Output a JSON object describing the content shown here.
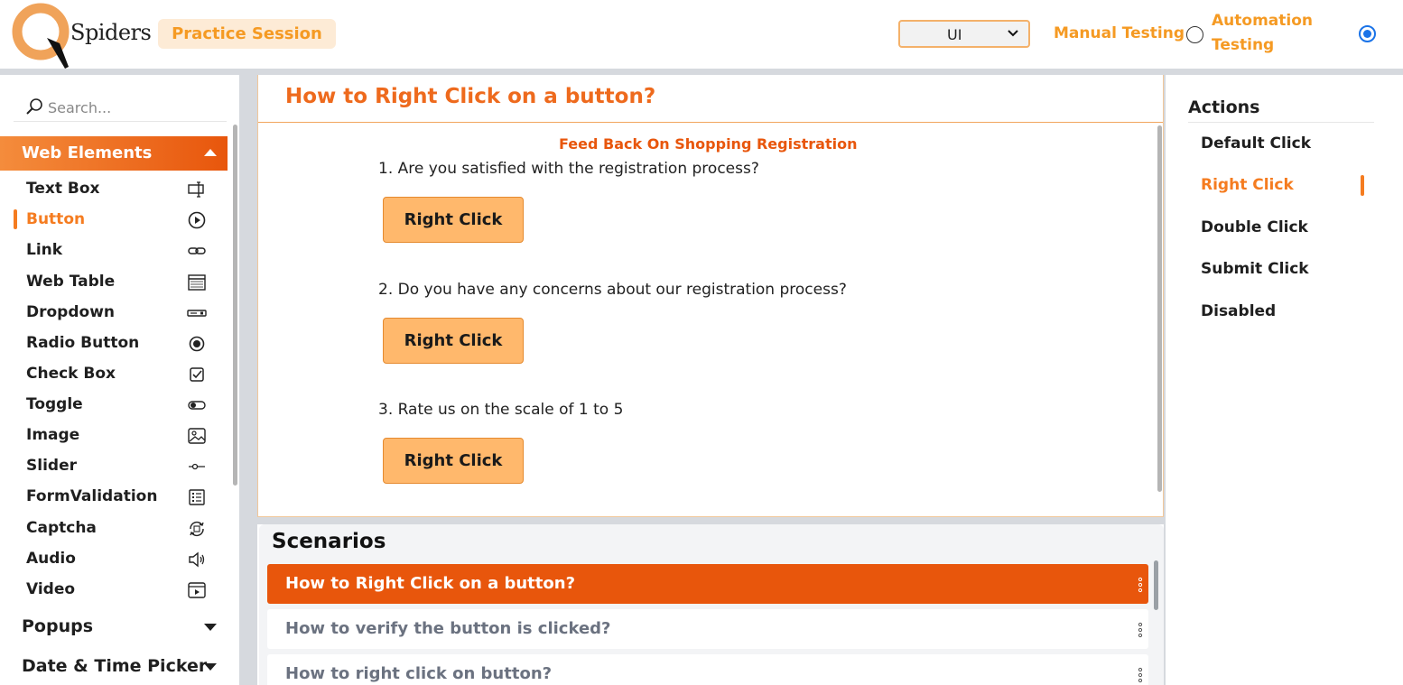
{
  "header": {
    "logo_text": "Spiders",
    "practice_label": "Practice Session",
    "mode_select_value": "UI",
    "manual_label": "Manual Testing",
    "automation_label_line1": "Automation",
    "automation_label_line2": "Testing"
  },
  "sidebar": {
    "search_placeholder": "Search...",
    "section_title": "Web Elements",
    "items": [
      {
        "label": "Text Box",
        "icon": "textbox-icon"
      },
      {
        "label": "Button",
        "icon": "play-circle-icon"
      },
      {
        "label": "Link",
        "icon": "link-icon"
      },
      {
        "label": "Web Table",
        "icon": "table-icon"
      },
      {
        "label": "Dropdown",
        "icon": "dropdown-icon"
      },
      {
        "label": "Radio Button",
        "icon": "radio-icon"
      },
      {
        "label": "Check Box",
        "icon": "checkbox-icon"
      },
      {
        "label": "Toggle",
        "icon": "toggle-icon"
      },
      {
        "label": "Image",
        "icon": "image-icon"
      },
      {
        "label": "Slider",
        "icon": "slider-icon"
      },
      {
        "label": "FormValidation",
        "icon": "form-icon"
      },
      {
        "label": "Captcha",
        "icon": "captcha-icon"
      },
      {
        "label": "Audio",
        "icon": "audio-icon"
      },
      {
        "label": "Video",
        "icon": "video-icon"
      }
    ],
    "groups": [
      {
        "label": "Popups"
      },
      {
        "label": "Date & Time Picker"
      }
    ]
  },
  "main": {
    "title": "How to Right Click on a button?",
    "feedback_title": "Feed Back On Shopping Registration",
    "questions": [
      {
        "text": "1. Are you satisfied with the registration process?",
        "button": "Right Click"
      },
      {
        "text": "2. Do you have any concerns about our registration process?",
        "button": "Right Click"
      },
      {
        "text": "3. Rate us on the scale of 1 to 5",
        "button": "Right Click"
      }
    ]
  },
  "scenarios": {
    "title": "Scenarios",
    "items": [
      {
        "label": "How to Right Click on a button?"
      },
      {
        "label": "How to verify the button is clicked?"
      },
      {
        "label": "How to right click on button?"
      }
    ]
  },
  "actions": {
    "title": "Actions",
    "items": [
      {
        "label": "Default Click"
      },
      {
        "label": "Right Click"
      },
      {
        "label": "Double Click"
      },
      {
        "label": "Submit Click"
      },
      {
        "label": "Disabled"
      }
    ]
  },
  "colors": {
    "accent": "#f57c20",
    "active_scenario": "#e8560c",
    "button_fill": "#ffb86c",
    "radio_selected": "#1a73e8"
  }
}
